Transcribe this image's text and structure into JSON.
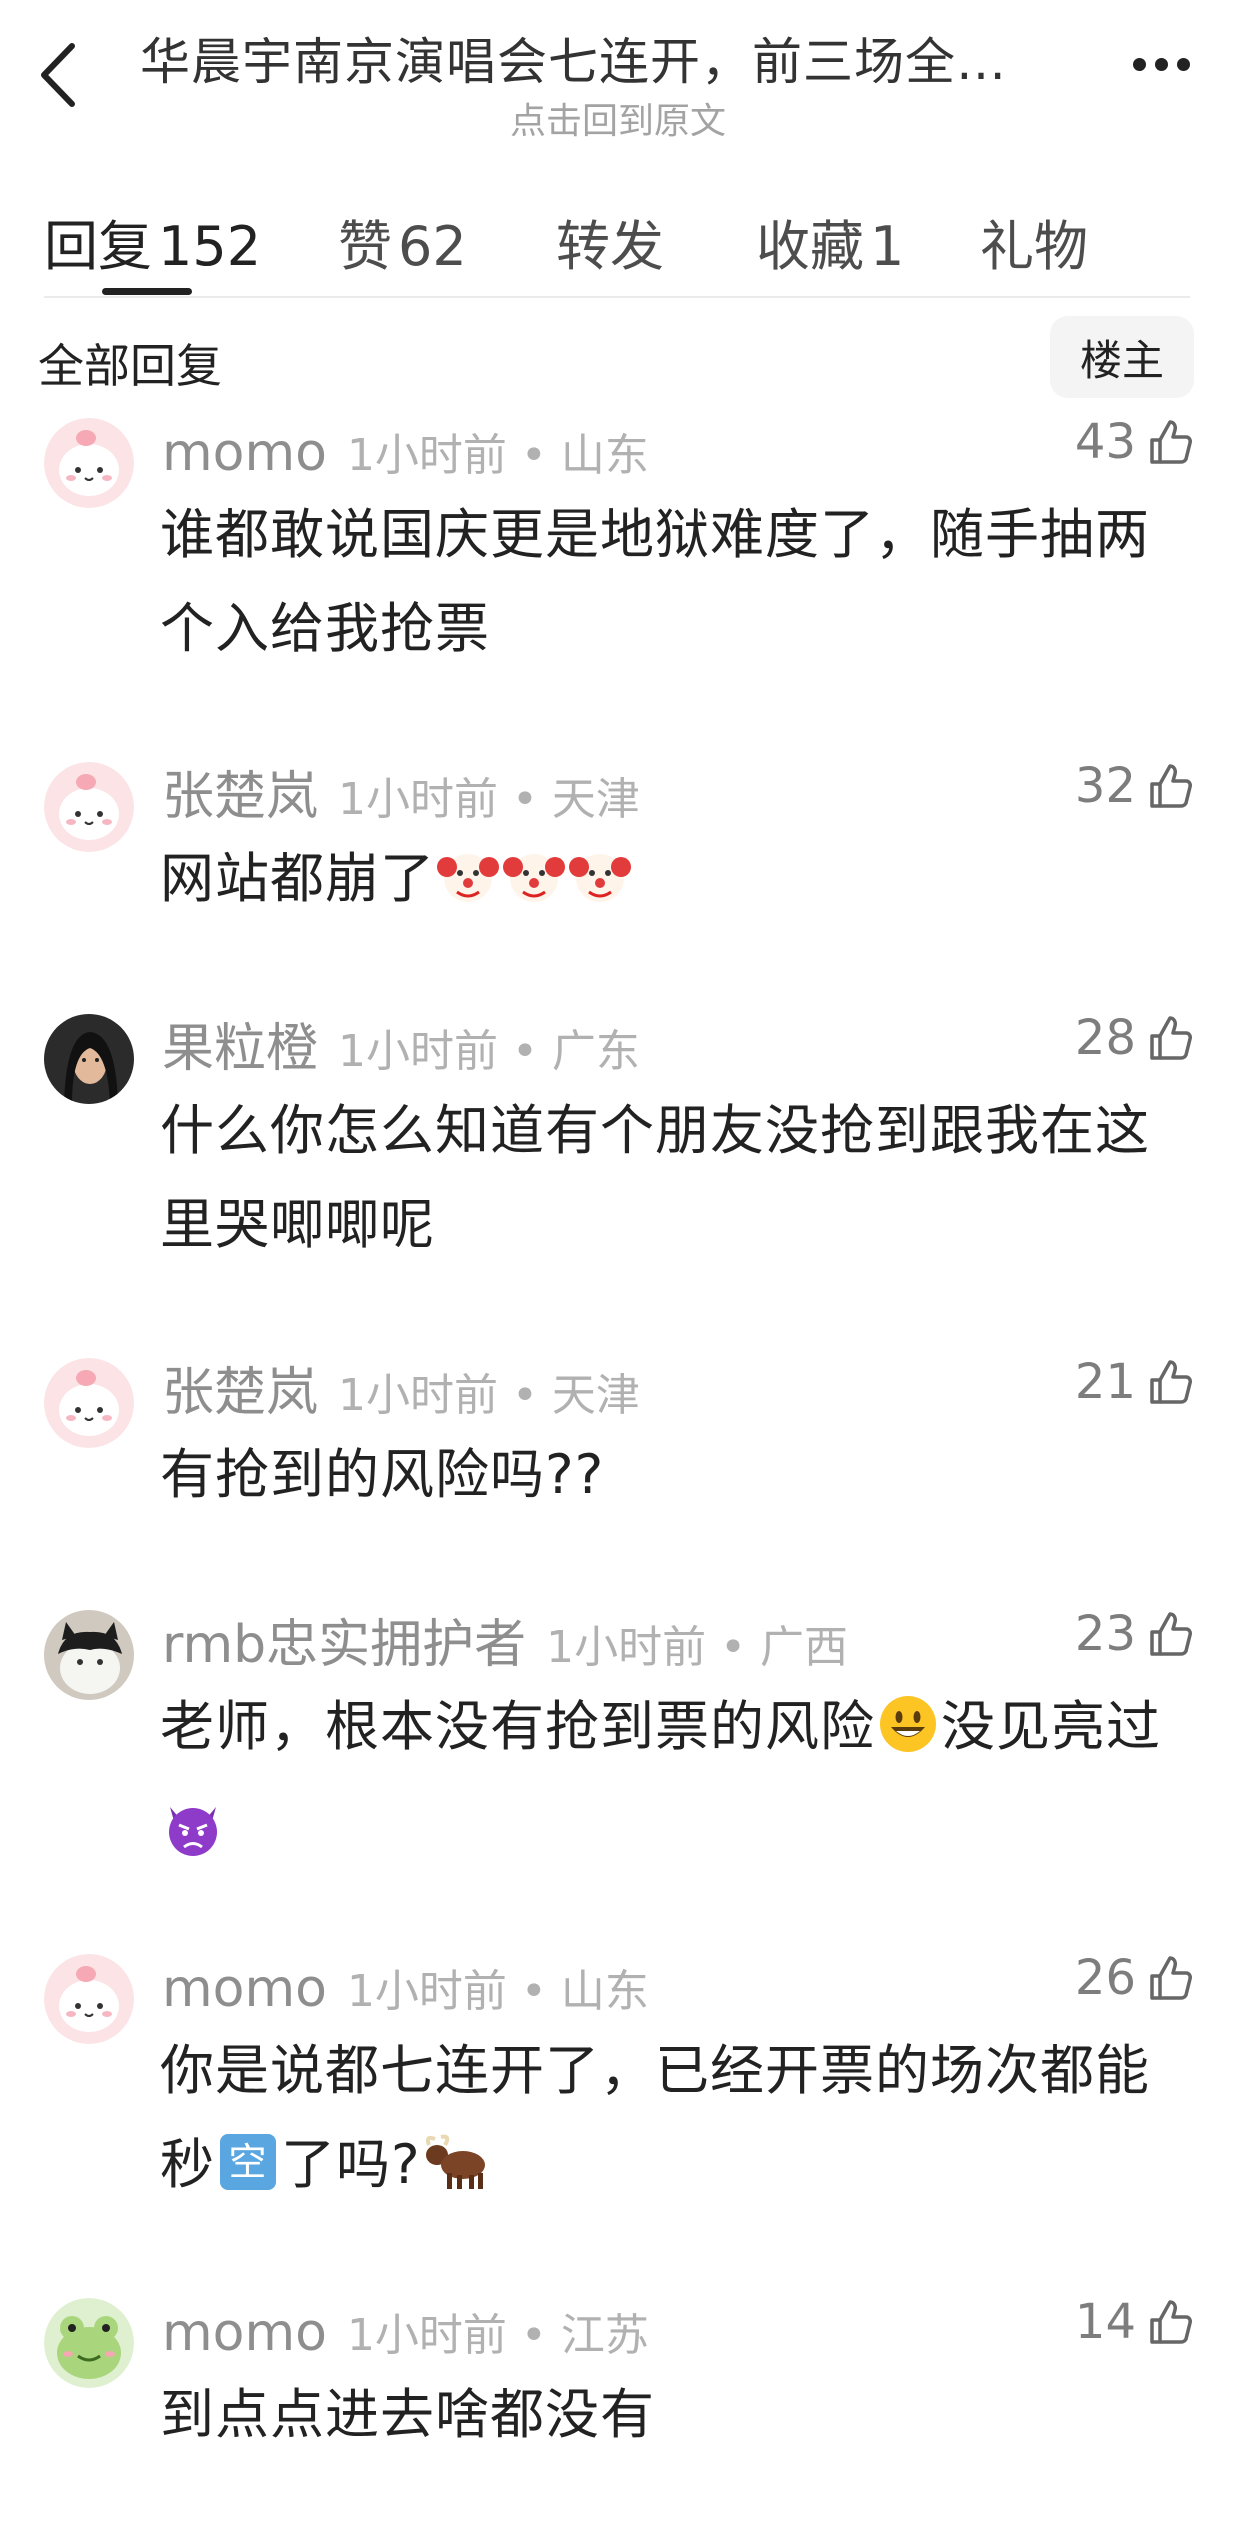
{
  "header": {
    "title": "华晨宇南京演唱会七连开，前三场全…",
    "subtitle": "点击回到原文"
  },
  "tabs": [
    {
      "label": "回复",
      "count": "152"
    },
    {
      "label": "赞",
      "count": "62"
    },
    {
      "label": "转发",
      "count": ""
    },
    {
      "label": "收藏",
      "count": "1"
    },
    {
      "label": "礼物",
      "count": ""
    }
  ],
  "filter": {
    "label": "全部回复",
    "host_button": "楼主"
  },
  "comments": [
    {
      "user": "momo",
      "time_location": "1小时前 • 山东",
      "likes": "43",
      "avatar": "pink-bunny-avatar",
      "segments": [
        "谁都敢说国庆更是地狱难度了，随手抽两个入给我抢票"
      ]
    },
    {
      "user": "张楚岚",
      "time_location": "1小时前 • 天津",
      "likes": "32",
      "avatar": "pink-bunny-avatar",
      "segments": [
        "网站都崩了"
      ],
      "emojis": [
        "clown-emoji",
        "clown-emoji",
        "clown-emoji"
      ]
    },
    {
      "user": "果粒橙",
      "time_location": "1小时前 • 广东",
      "likes": "28",
      "avatar": "photo-portrait-avatar",
      "segments": [
        "什么你怎么知道有个朋友没抢到跟我在这里哭唧唧呢"
      ]
    },
    {
      "user": "张楚岚",
      "time_location": "1小时前 • 天津",
      "likes": "21",
      "avatar": "pink-bunny-avatar",
      "segments": [
        "有抢到的风险吗??"
      ]
    },
    {
      "user": "rmb忠实拥护者",
      "time_location": "1小时前 • 广西",
      "likes": "23",
      "avatar": "cat-photo-avatar",
      "segments": [
        "老师，根本没有抢到票的风险",
        "没见亮过"
      ],
      "emojis": [
        "smiley-emoji",
        "angry-devil-emoji"
      ]
    },
    {
      "user": "momo",
      "time_location": "1小时前 • 山东",
      "likes": "26",
      "avatar": "pink-bunny-avatar",
      "segments": [
        "你是说都七连开了，已经开票的场次都能秒",
        "了吗?"
      ],
      "emojis": [
        "kong-square-emoji",
        "ox-emoji"
      ],
      "emoji_text": "空"
    },
    {
      "user": "momo",
      "time_location": "1小时前 • 江苏",
      "likes": "14",
      "avatar": "green-frog-avatar",
      "segments": [
        "到点点进去啥都没有"
      ]
    }
  ],
  "colors": {
    "text": "#222222",
    "meta": "#8e8e8e",
    "time": "#b1b1b1",
    "divider": "#ebebeb"
  }
}
